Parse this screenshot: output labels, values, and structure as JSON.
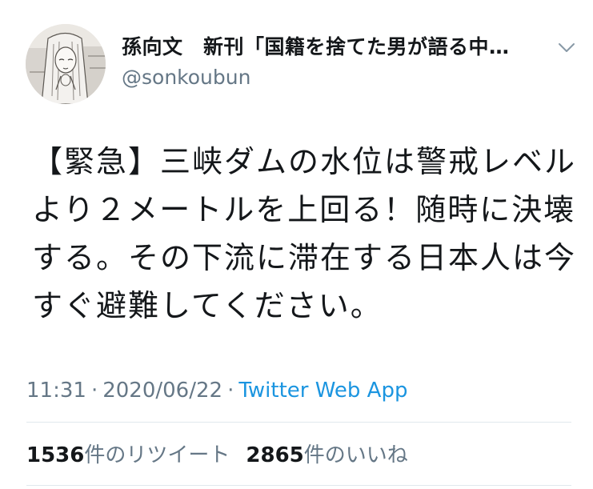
{
  "author": {
    "display_name": "孫向文　新刊「国籍を捨てた男が語る中…",
    "handle": "@sonkoubun"
  },
  "tweet": {
    "text": "【緊急】三峡ダムの水位は警戒レベルより２メートルを上回る！随時に決壊する。その下流に滞在する日本人は今すぐ避難してください。"
  },
  "meta": {
    "time": "11:31",
    "date": "2020/06/22",
    "separator": "·",
    "source": "Twitter Web App"
  },
  "stats": {
    "retweets": {
      "count": "1536",
      "label": "件のリツイート"
    },
    "likes": {
      "count": "2865",
      "label": "件のいいね"
    }
  },
  "icons": {
    "menu": "chevron-down-icon",
    "avatar": "profile-avatar"
  },
  "colors": {
    "text": "#14171a",
    "secondary": "#657786",
    "link": "#1b95e0",
    "divider": "#e1e8ed"
  }
}
